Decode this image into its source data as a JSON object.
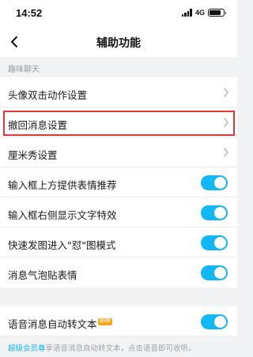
{
  "status_bar": {
    "time": "14:52",
    "network": "4G",
    "battery_level": 0.85
  },
  "nav": {
    "title": "辅助功能",
    "back_icon": "chevron-left-icon"
  },
  "section": {
    "header": "趣味聊天"
  },
  "rows": [
    {
      "label": "头像双击动作设置",
      "control": "chevron"
    },
    {
      "label": "撤回消息设置",
      "control": "chevron",
      "highlighted": true
    },
    {
      "label": "厘米秀设置",
      "control": "chevron"
    },
    {
      "label": "输入框上方提供表情推荐",
      "control": "toggle",
      "on": true
    },
    {
      "label": "输入框右侧显示文字特效",
      "control": "toggle",
      "on": true
    },
    {
      "label": "快速发图进入\"怼\"图模式",
      "control": "toggle",
      "on": true
    },
    {
      "label": "消息气泡贴表情",
      "control": "toggle",
      "on": true
    }
  ],
  "voice": {
    "label": "语音消息自动转文本",
    "badge": "SVIP",
    "on": true
  },
  "vip_note": {
    "link": "超级会员尊",
    "text": "享语音消息自动转文本，点击语音即可收听。"
  },
  "colors": {
    "accent": "#12b7f5",
    "highlight_border": "#e0383a",
    "badge": "#f6a623"
  }
}
